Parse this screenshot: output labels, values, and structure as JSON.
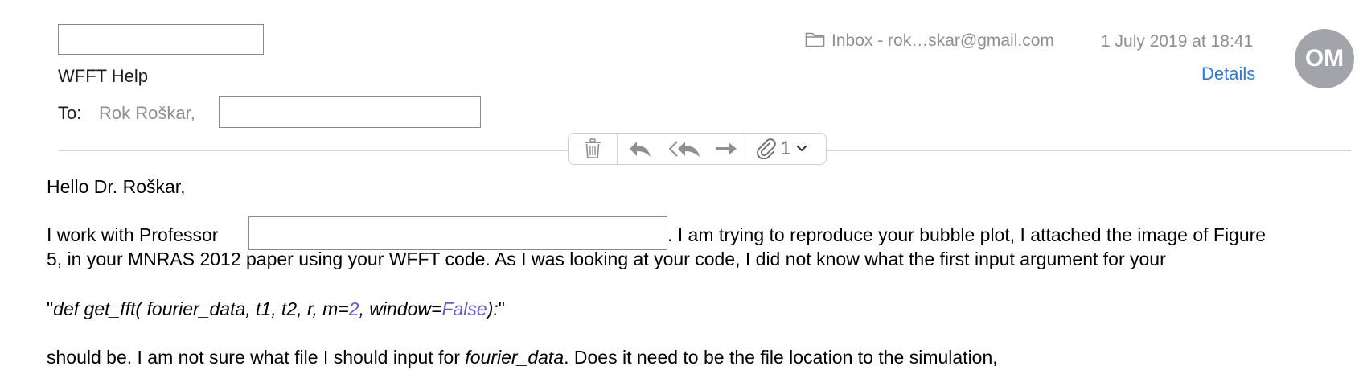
{
  "header": {
    "subject": "WFFT Help",
    "to_label": "To:",
    "to_recipient": "Rok Roškar,",
    "mailbox": "Inbox - rok…skar@gmail.com",
    "date": "1 July 2019 at 18:41",
    "details_label": "Details",
    "avatar_initials": "OM"
  },
  "toolbar": {
    "attachment_count": "1"
  },
  "body": {
    "greeting": "Hello Dr. Roškar,",
    "p1_start": "I work with Professor",
    "p1_end": ". I am trying to reproduce your bubble plot, I attached the image of Figure",
    "p1_line2": "5, in your MNRAS 2012 paper using your WFFT code. As I was looking at your code, I did not know what the first input argument for your",
    "code_open_quote": "\"",
    "code_sig": "def get_fft( fourier_data, t1, t2, r, m=",
    "code_m_val": "2",
    "code_sep": ", window=",
    "code_win_val": "False",
    "code_close": "):",
    "code_close_quote": "\"",
    "p2_start": "should be. I am not sure what file I should input for ",
    "p2_italic": "fourier_data",
    "p2_end": ". Does it need to be the file location to the simulation,"
  },
  "colors": {
    "link": "#2b7bde",
    "avatar_bg": "#a3a4a9",
    "code_keyword": "#6a5acd"
  },
  "icons": [
    "folder-icon",
    "trash-icon",
    "reply-icon",
    "reply-all-icon",
    "forward-icon",
    "paperclip-icon",
    "chevron-down-icon"
  ]
}
